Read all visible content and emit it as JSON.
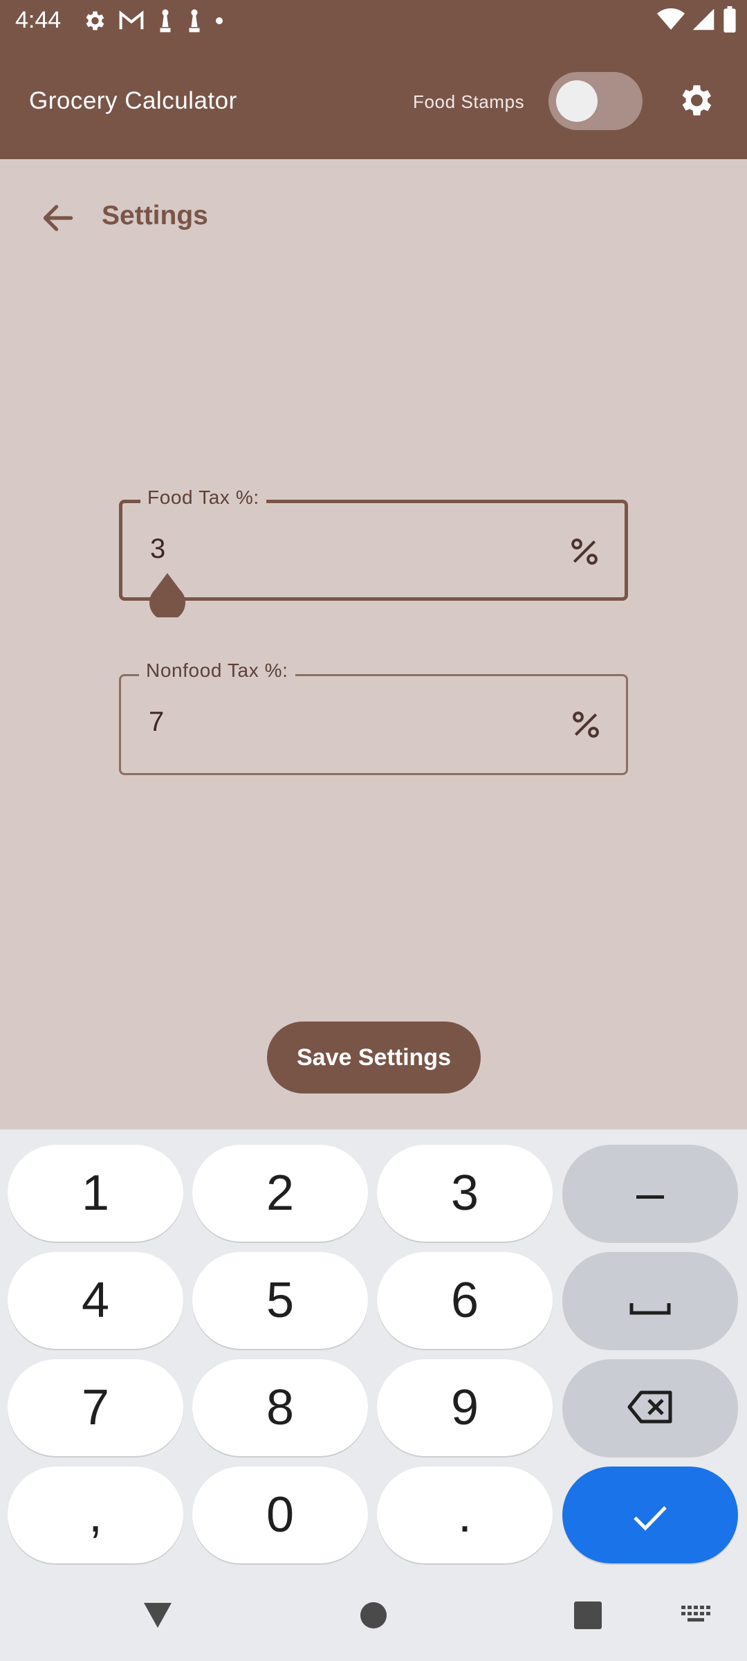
{
  "status_bar": {
    "time": "4:44"
  },
  "app_bar": {
    "title": "Grocery Calculator",
    "food_stamps_label": "Food Stamps",
    "food_stamps_enabled": false
  },
  "settings": {
    "title": "Settings"
  },
  "fields": {
    "food_tax": {
      "label": "Food Tax %:",
      "value": "3"
    },
    "nonfood_tax": {
      "label": "Nonfood Tax %:",
      "value": "7"
    }
  },
  "save_button": {
    "label": "Save Settings"
  },
  "keyboard": {
    "keys": {
      "k1": "1",
      "k2": "2",
      "k3": "3",
      "minus": "–",
      "k4": "4",
      "k5": "5",
      "k6": "6",
      "k7": "7",
      "k8": "8",
      "k9": "9",
      "comma": ",",
      "k0": "0",
      "period": "."
    }
  },
  "colors": {
    "primary": "#795548",
    "background": "#d7cac6",
    "keyboard_bg": "#e8eaed",
    "accent_blue": "#1a73e8"
  }
}
